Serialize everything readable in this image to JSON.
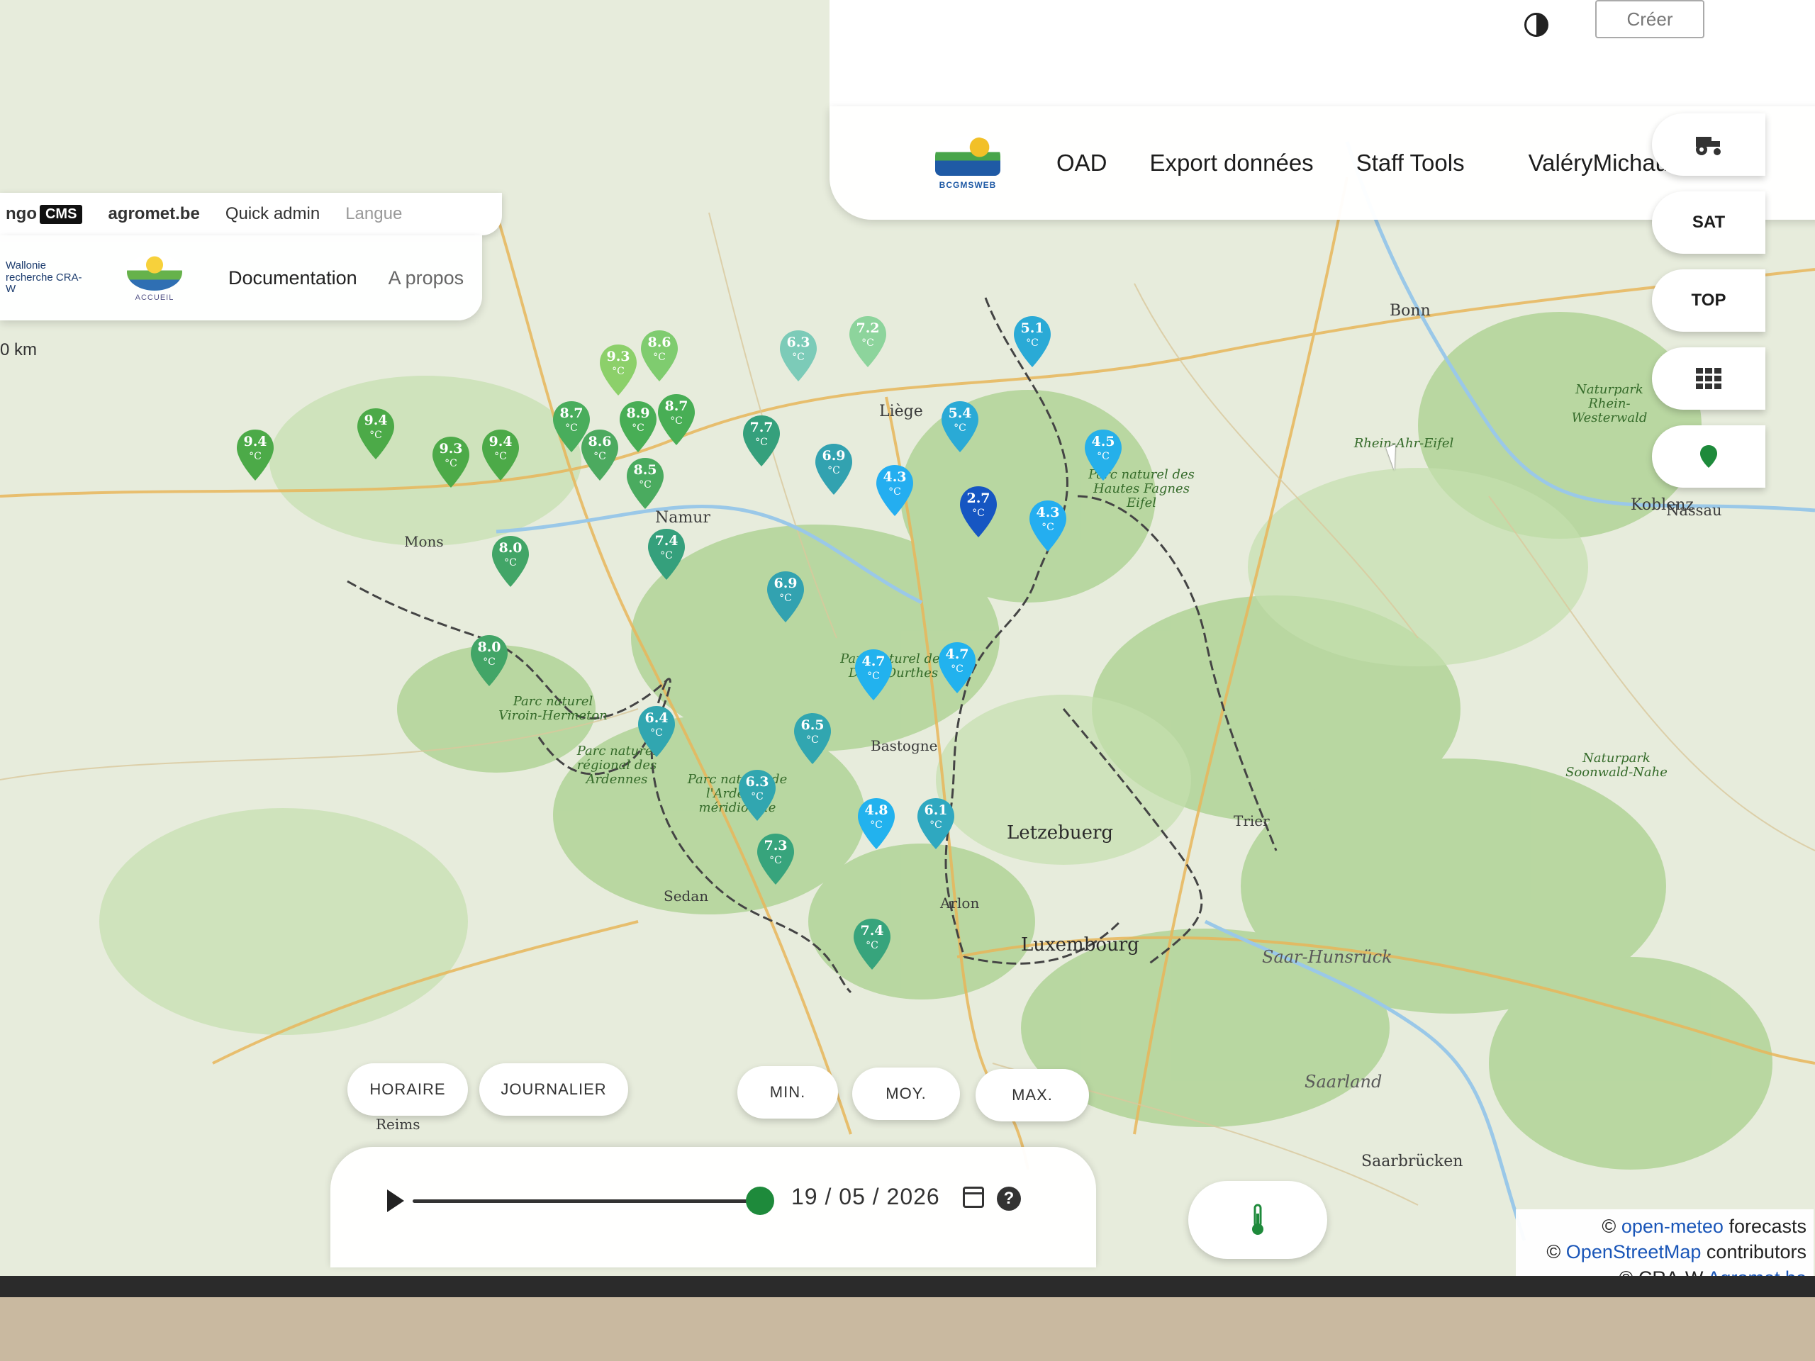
{
  "cms_bar": {
    "logo_text": "ngo",
    "logo_badge": "CMS",
    "site": "agromet.be",
    "quick_admin": "Quick admin",
    "language": "Langue"
  },
  "left_nav": {
    "partner_text": "Wallonie recherche CRA-W",
    "home_label": "ACCUEIL",
    "documentation": "Documentation",
    "about": "A propos"
  },
  "top_bar": {
    "create_label": "Créer",
    "contrast_icon": "contrast-icon"
  },
  "main_nav": {
    "brand": "BCGMSWEB",
    "items": [
      "OAD",
      "Export données",
      "Staff Tools"
    ],
    "user": "ValéryMichaud"
  },
  "side_buttons": [
    {
      "label": "",
      "icon": "tractor-icon"
    },
    {
      "label": "SAT",
      "icon": ""
    },
    {
      "label": "TOP",
      "icon": ""
    },
    {
      "label": "",
      "icon": "grid-icon"
    },
    {
      "label": "",
      "icon": "map-pin-icon"
    }
  ],
  "scale_label": "0 km",
  "temperature_unit": "°C",
  "stations": [
    {
      "value": "9.4",
      "color": "#4caa48"
    },
    {
      "value": "9.4",
      "color": "#4caa48"
    },
    {
      "value": "9.3",
      "color": "#4caa48"
    },
    {
      "value": "9.4",
      "color": "#4caa48"
    },
    {
      "value": "8.7",
      "color": "#49ad5c"
    },
    {
      "value": "8.6",
      "color": "#4caa5f"
    },
    {
      "value": "8.9",
      "color": "#48ae55"
    },
    {
      "value": "8.7",
      "color": "#48ae55"
    },
    {
      "value": "9.3",
      "color": "#8cd06a"
    },
    {
      "value": "8.6",
      "color": "#7fcc6f"
    },
    {
      "value": "8.5",
      "color": "#4aab5f"
    },
    {
      "value": "8.0",
      "color": "#42a567"
    },
    {
      "value": "8.0",
      "color": "#42a567"
    },
    {
      "value": "7.4",
      "color": "#35a07c"
    },
    {
      "value": "7.7",
      "color": "#35a07c"
    },
    {
      "value": "6.3",
      "color": "#7ccbb8"
    },
    {
      "value": "7.2",
      "color": "#8dd49c"
    },
    {
      "value": "6.9",
      "color": "#32a2b0"
    },
    {
      "value": "6.9",
      "color": "#32a2b0"
    },
    {
      "value": "5.1",
      "color": "#2aaad6"
    },
    {
      "value": "5.4",
      "color": "#2aaad6"
    },
    {
      "value": "4.5",
      "color": "#25b0ea"
    },
    {
      "value": "4.3",
      "color": "#24aef0"
    },
    {
      "value": "2.7",
      "color": "#1656c2"
    },
    {
      "value": "4.3",
      "color": "#24aef0"
    },
    {
      "value": "4.7",
      "color": "#22b2ee"
    },
    {
      "value": "4.7",
      "color": "#22b2ee"
    },
    {
      "value": "6.4",
      "color": "#31a6b0"
    },
    {
      "value": "6.5",
      "color": "#31a6b0"
    },
    {
      "value": "6.3",
      "color": "#31a6b0"
    },
    {
      "value": "4.8",
      "color": "#22b2ee"
    },
    {
      "value": "6.1",
      "color": "#2fa8c0"
    },
    {
      "value": "7.3",
      "color": "#37a47c"
    },
    {
      "value": "7.4",
      "color": "#37a47c"
    }
  ],
  "map_labels": {
    "luxembourg_big": "Letzebuerg",
    "luxembourg_city": "Luxembourg",
    "saar": "Saar-Hunsrück",
    "park_nassau": "Nassau",
    "liege": "Liège",
    "namur": "Namur",
    "koblenz": "Koblenz",
    "bonn": "Bonn",
    "arlon": "Arlon",
    "bastogne": "Bastogne",
    "sedan": "Sedan",
    "saarbrucken": "Saarbrücken",
    "trier": "Trier",
    "reims": "Reims",
    "mons": "Mons",
    "park_ardenne": "Parc naturel régional des Ardennes",
    "park_hautes_fagnes": "Parc naturel des Hautes Fagnes Eifel",
    "park_rhein_westerwald": "Naturpark Rhein-Westerwald",
    "park_soonwald": "Naturpark Soonwald-Nahe",
    "park_viroin": "Parc naturel Viroin-Hermeton",
    "park_ardenne_meridionale": "Parc naturel de l'Ardenne méridionale",
    "park_deux_ourthes": "Parc naturel des Deux Ourthes",
    "rhein_ahr": "Rhein-Ahr-Eifel",
    "region_saarland": "Saarland"
  },
  "controls": {
    "horaire": "HORAIRE",
    "journalier": "JOURNALIER",
    "min": "MIN.",
    "moy": "MOY.",
    "max": "MAX."
  },
  "timeline": {
    "date": "19 / 05 / 2026",
    "progress": 1.0
  },
  "attribution": {
    "line1_link": "open-meteo",
    "line1_rest": "forecasts",
    "line2_link": "OpenStreetMap",
    "line2_rest": "contributors",
    "line3_prefix": "© CRA-W",
    "line3_link": "Agromet.be"
  }
}
